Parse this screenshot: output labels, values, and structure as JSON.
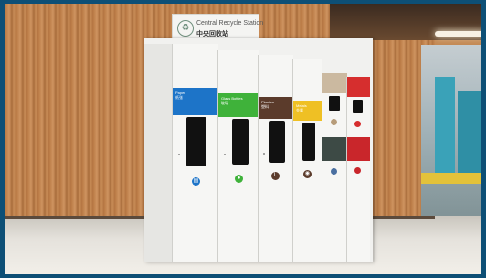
{
  "sign": {
    "title": "Central Recycle Station",
    "subtitle": "中央回收站",
    "icon": "recycle-icon"
  },
  "bins": [
    {
      "label": "Paper",
      "label_cn": "纸张",
      "color": "#1d74c8",
      "icon": "paper-icon"
    },
    {
      "label": "Glass Bottles",
      "label_cn": "玻璃",
      "color": "#3fb23a",
      "icon": "bottle-icon"
    },
    {
      "label": "Plastics",
      "label_cn": "塑料",
      "color": "#5b3b2b",
      "icon": "plastic-icon"
    },
    {
      "label": "Metals",
      "label_cn": "金属",
      "color": "#efc024",
      "icon": "can-icon"
    }
  ],
  "small_bins": [
    {
      "color": "#cbb9a0",
      "icon_color": "#b79c7a"
    },
    {
      "color": "#d62e2e",
      "icon_color": "#d62e2e"
    },
    {
      "color": "#3d4a45",
      "icon_color": "#4a6fa0"
    },
    {
      "color": "#c9262b",
      "icon_color": "#c9262b"
    }
  ]
}
